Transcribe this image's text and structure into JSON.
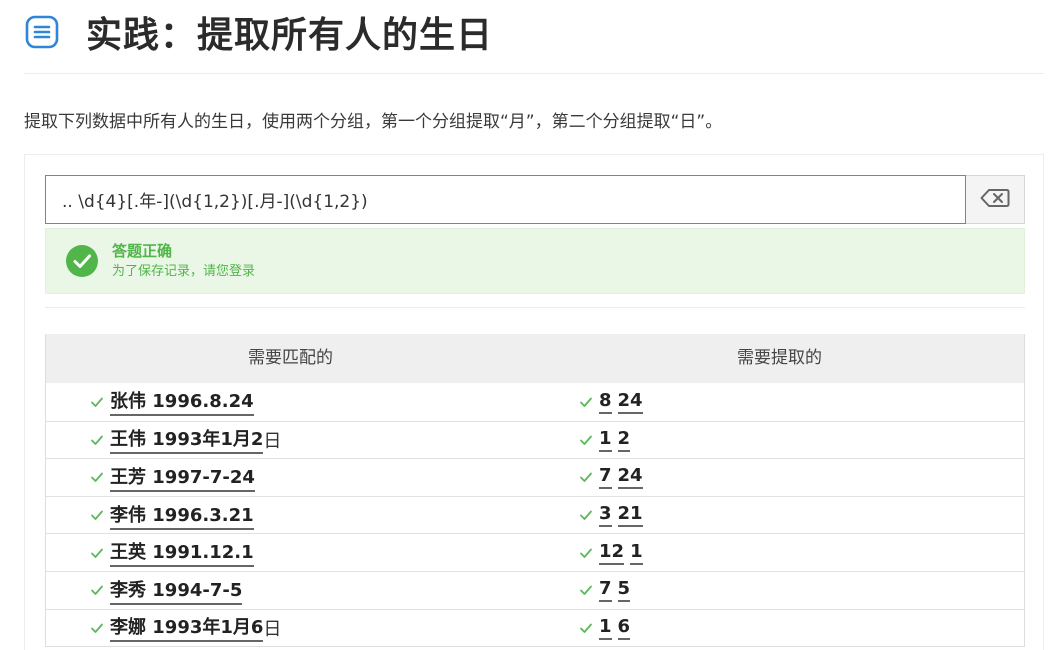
{
  "header": {
    "title": "实践：提取所有人的生日",
    "icon": "list-menu-icon"
  },
  "task": {
    "description": "提取下列数据中所有人的生日，使用两个分组，第一个分组提取“月”，第二个分组提取“日”。"
  },
  "regex": {
    "value": ".. \\d{4}[.年-](\\d{1,2})[.月-](\\d{1,2})",
    "clear_icon": "backspace-icon"
  },
  "result": {
    "status_title": "答题正确",
    "status_sub": "为了保存记录，请您登录",
    "status_color": "#52b54a"
  },
  "table": {
    "col_match": "需要匹配的",
    "col_extract": "需要提取的",
    "rows": [
      {
        "match": "张伟 1996.8.24",
        "rest": "",
        "g1": "8",
        "g2": "24"
      },
      {
        "match": "王伟 1993年1月2",
        "rest": "日",
        "g1": "1",
        "g2": "2"
      },
      {
        "match": "王芳 1997-7-24",
        "rest": "",
        "g1": "7",
        "g2": "24"
      },
      {
        "match": "李伟 1996.3.21",
        "rest": "",
        "g1": "3",
        "g2": "21"
      },
      {
        "match": "王英 1991.12.1",
        "rest": "",
        "g1": "12",
        "g2": "1"
      },
      {
        "match": "李秀 1994-7-5",
        "rest": "",
        "g1": "7",
        "g2": "5"
      },
      {
        "match": "李娜 1993年1月6",
        "rest": "日",
        "g1": "1",
        "g2": "6"
      }
    ]
  }
}
